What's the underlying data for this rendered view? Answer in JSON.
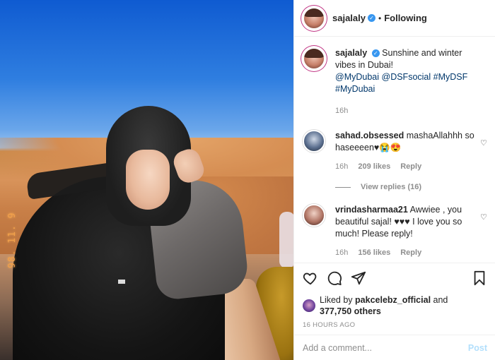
{
  "post": {
    "username": "sajalaly",
    "follow_status": "Following",
    "dot": "•",
    "more_label": "..."
  },
  "caption": {
    "username": "sajalaly",
    "text": "Sunshine and winter vibes in Dubai!",
    "tags": [
      "@MyDubai",
      "@DSFsocial",
      "#MyDSF",
      "#MyDubai"
    ],
    "time": "16h"
  },
  "comments": [
    {
      "username": "sahad.obsessed",
      "text": "mashaAllahhh so haseeeen♥😭😍",
      "time": "16h",
      "likes": "209 likes",
      "reply_label": "Reply"
    },
    {
      "username": "vrindasharmaa21",
      "text": "Awwiee , you beautiful sajal! ♥♥♥ I love you so much! Please reply!",
      "time": "16h",
      "likes": "156 likes",
      "reply_label": "Reply"
    }
  ],
  "view_replies": "View replies (16)",
  "likes": {
    "prefix": "Liked by",
    "user": "pakcelebz_official",
    "joiner": "and",
    "count": "377,750 others"
  },
  "timestamp": "16 HOURS AGO",
  "comment_box": {
    "placeholder": "Add a comment...",
    "post_label": "Post"
  },
  "photo": {
    "date_stamp": "98. 11. 9"
  },
  "icons": {
    "verified": "✓",
    "heart": "♡"
  },
  "colors": {
    "link": "#00376b",
    "verified": "#3897f0",
    "post_disabled": "#b2dffc",
    "muted": "#8e8e8e"
  }
}
